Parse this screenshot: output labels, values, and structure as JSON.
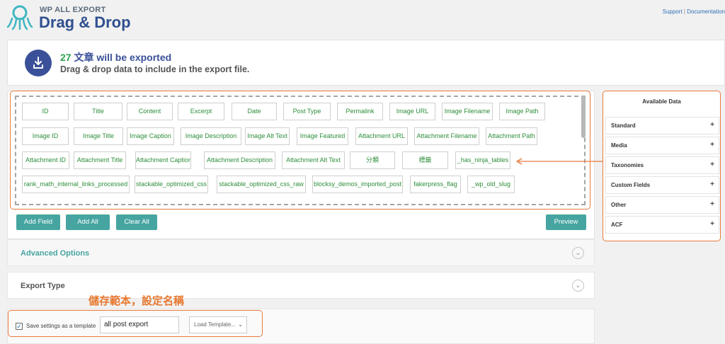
{
  "header": {
    "brand_small": "WP ALL EXPORT",
    "brand_big": "Drag & Drop",
    "links": {
      "support": "Support",
      "separator": "|",
      "documentation": "Documentation"
    }
  },
  "banner": {
    "count": "27",
    "title_suffix": " 文章 will be exported",
    "subtitle": "Drag & drop data to include in the export file."
  },
  "fields": [
    "ID",
    "Title",
    "Content",
    "Excerpt",
    "Date",
    "Post Type",
    "Permalink",
    "Image URL",
    "Image Filename",
    "Image Path",
    "Image ID",
    "Image Title",
    "Image Caption",
    "Image Description",
    "Image Alt Text",
    "Image Featured",
    "Attachment URL",
    "Attachment Filename",
    "Attachment Path",
    "Attachment ID",
    "Attachment Title",
    "Attachment Caption",
    "Attachment Description",
    "Attachment Alt Text",
    "分類",
    "標籤",
    "_has_ninja_tables",
    "rank_math_internal_links_processed",
    "stackable_optimized_css",
    "stackable_optimized_css_raw",
    "blocksy_demos_imported_post",
    "fakerpress_flag",
    "_wp_old_slug"
  ],
  "buttons": {
    "add_field": "Add Field",
    "add_all": "Add All",
    "clear_all": "Clear All",
    "preview": "Preview"
  },
  "sections": {
    "advanced_options": "Advanced Options",
    "export_type": "Export Type"
  },
  "annotation": "儲存範本，設定名稱",
  "template": {
    "save_label": "Save settings as a template",
    "save_checked": true,
    "name_value": "all post export",
    "load_placeholder": "Load Template..."
  },
  "available_data": {
    "title": "Available Data",
    "groups": [
      "Standard",
      "Media",
      "Taxonomies",
      "Custom Fields",
      "Other",
      "ACF"
    ]
  },
  "colors": {
    "accent_teal": "#46a5a1",
    "brand_navy": "#3a5199",
    "field_green": "#2e8f3a",
    "highlight_orange": "#e87a3e"
  }
}
